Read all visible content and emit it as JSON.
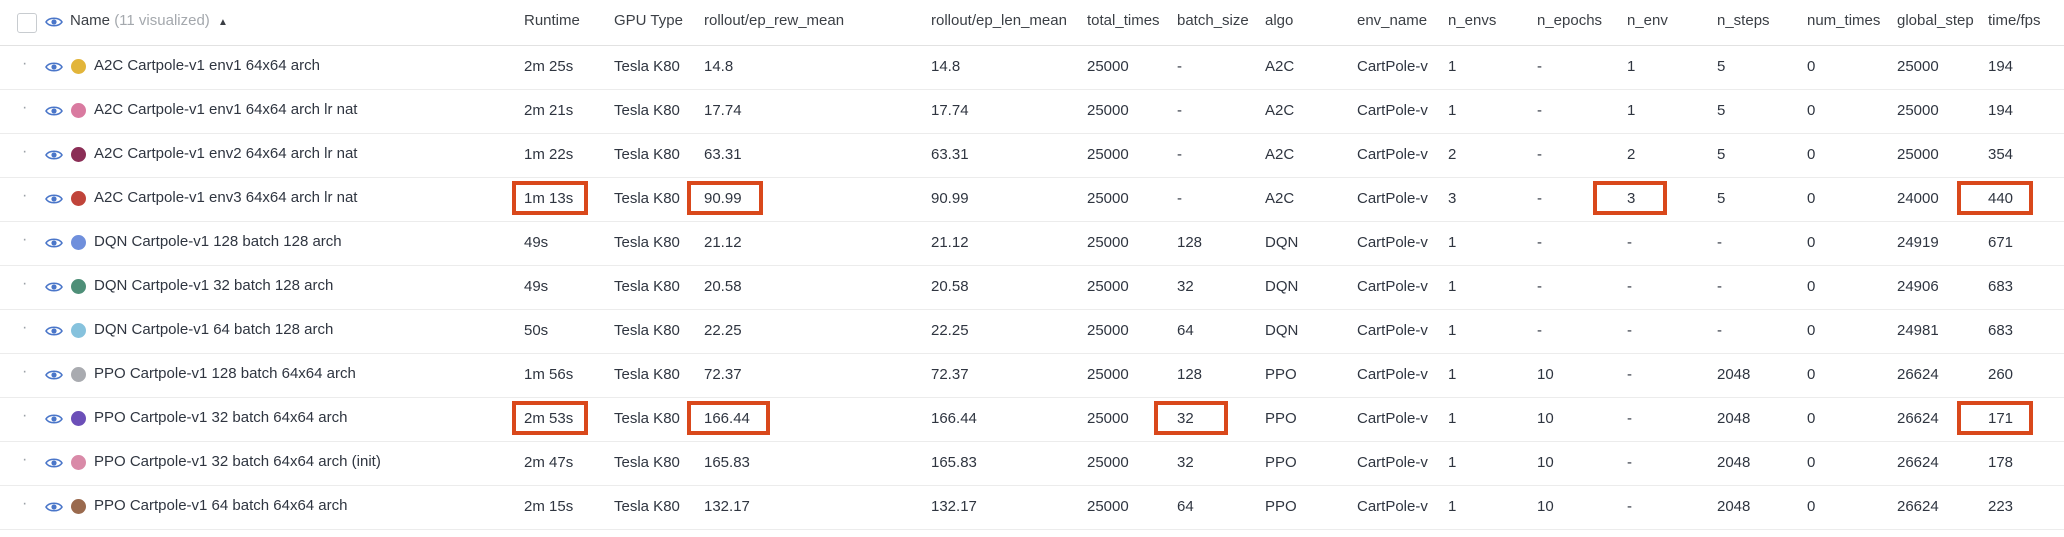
{
  "header": {
    "name_label": "Name",
    "visualized_count": "(11 visualized)",
    "columns": [
      "Runtime",
      "GPU Type",
      "rollout/ep_rew_mean",
      "rollout/ep_len_mean",
      "total_times",
      "batch_size",
      "algo",
      "env_name",
      "n_envs",
      "n_epochs",
      "n_env",
      "n_steps",
      "num_times",
      "global_step",
      "time/fps"
    ]
  },
  "rows": [
    {
      "name": "A2C Cartpole-v1 env1 64x64 arch",
      "color": "#e2b53a",
      "cells": [
        "2m 25s",
        "Tesla K80",
        "14.8",
        "14.8",
        "25000",
        "-",
        "A2C",
        "CartPole-v",
        "1",
        "-",
        "1",
        "5",
        "0",
        "25000",
        "194"
      ]
    },
    {
      "name": "A2C Cartpole-v1 env1 64x64 arch lr nat",
      "color": "#d97aa0",
      "cells": [
        "2m 21s",
        "Tesla K80",
        "17.74",
        "17.74",
        "25000",
        "-",
        "A2C",
        "CartPole-v",
        "1",
        "-",
        "1",
        "5",
        "0",
        "25000",
        "194"
      ]
    },
    {
      "name": "A2C Cartpole-v1 env2 64x64 arch lr nat",
      "color": "#8b2e56",
      "cells": [
        "1m 22s",
        "Tesla K80",
        "63.31",
        "63.31",
        "25000",
        "-",
        "A2C",
        "CartPole-v",
        "2",
        "-",
        "2",
        "5",
        "0",
        "25000",
        "354"
      ]
    },
    {
      "name": "A2C Cartpole-v1 env3 64x64 arch lr nat",
      "color": "#c0443a",
      "cells": [
        "1m 13s",
        "Tesla K80",
        "90.99",
        "90.99",
        "25000",
        "-",
        "A2C",
        "CartPole-v",
        "3",
        "-",
        "3",
        "5",
        "0",
        "24000",
        "440"
      ]
    },
    {
      "name": "DQN Cartpole-v1 128 batch 128 arch",
      "color": "#6f8fdc",
      "cells": [
        "49s",
        "Tesla K80",
        "21.12",
        "21.12",
        "25000",
        "128",
        "DQN",
        "CartPole-v",
        "1",
        "-",
        "-",
        "-",
        "0",
        "24919",
        "671"
      ]
    },
    {
      "name": "DQN Cartpole-v1 32 batch 128 arch",
      "color": "#4e8f78",
      "cells": [
        "49s",
        "Tesla K80",
        "20.58",
        "20.58",
        "25000",
        "32",
        "DQN",
        "CartPole-v",
        "1",
        "-",
        "-",
        "-",
        "0",
        "24906",
        "683"
      ]
    },
    {
      "name": "DQN Cartpole-v1 64 batch 128 arch",
      "color": "#86c2dd",
      "cells": [
        "50s",
        "Tesla K80",
        "22.25",
        "22.25",
        "25000",
        "64",
        "DQN",
        "CartPole-v",
        "1",
        "-",
        "-",
        "-",
        "0",
        "24981",
        "683"
      ]
    },
    {
      "name": "PPO Cartpole-v1 128 batch 64x64 arch",
      "color": "#a9abb0",
      "cells": [
        "1m 56s",
        "Tesla K80",
        "72.37",
        "72.37",
        "25000",
        "128",
        "PPO",
        "CartPole-v",
        "1",
        "10",
        "-",
        "2048",
        "0",
        "26624",
        "260"
      ]
    },
    {
      "name": "PPO Cartpole-v1 32 batch 64x64 arch",
      "color": "#6c4fb8",
      "cells": [
        "2m 53s",
        "Tesla K80",
        "166.44",
        "166.44",
        "25000",
        "32",
        "PPO",
        "CartPole-v",
        "1",
        "10",
        "-",
        "2048",
        "0",
        "26624",
        "171"
      ]
    },
    {
      "name": "PPO Cartpole-v1 32 batch 64x64 arch (init)",
      "color": "#d98aa8",
      "cells": [
        "2m 47s",
        "Tesla K80",
        "165.83",
        "165.83",
        "25000",
        "32",
        "PPO",
        "CartPole-v",
        "1",
        "10",
        "-",
        "2048",
        "0",
        "26624",
        "178"
      ]
    },
    {
      "name": "PPO Cartpole-v1 64 batch 64x64 arch",
      "color": "#9a6a4e",
      "cells": [
        "2m 15s",
        "Tesla K80",
        "132.17",
        "132.17",
        "25000",
        "64",
        "PPO",
        "CartPole-v",
        "1",
        "10",
        "-",
        "2048",
        "0",
        "26624",
        "223"
      ]
    }
  ],
  "highlight_color": "#d9481b"
}
